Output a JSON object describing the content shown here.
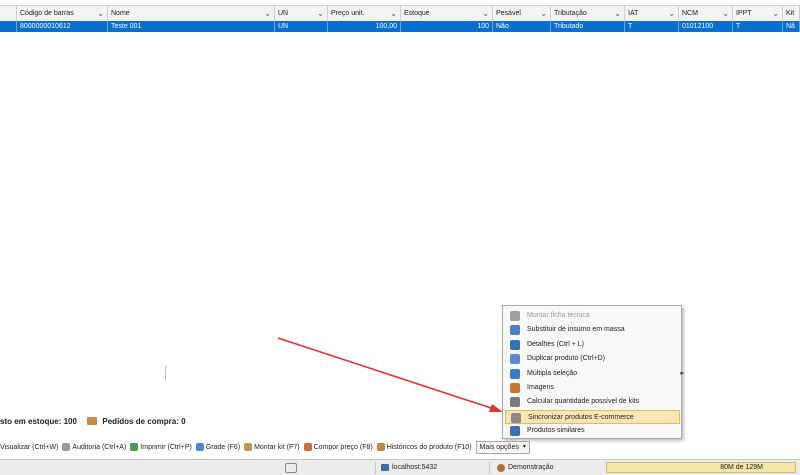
{
  "grid": {
    "columns": [
      {
        "label": "",
        "width": 17
      },
      {
        "label": "Código de barras",
        "width": 91
      },
      {
        "label": "Nome",
        "width": 167
      },
      {
        "label": "UN",
        "width": 53
      },
      {
        "label": "Preço unit.",
        "width": 73
      },
      {
        "label": "Estoque",
        "width": 92
      },
      {
        "label": "Pesável",
        "width": 58
      },
      {
        "label": "Tributação",
        "width": 74
      },
      {
        "label": "IAT",
        "width": 54
      },
      {
        "label": "NCM",
        "width": 54
      },
      {
        "label": "IPPT",
        "width": 50
      },
      {
        "label": "Kit",
        "width": 17
      }
    ],
    "rows": [
      {
        "cells": [
          "",
          "8000000010612",
          "Teste 001",
          "UN",
          "100,00",
          "100",
          "Não",
          "Tributado",
          "T",
          "01012100",
          "T",
          "Nã"
        ]
      }
    ]
  },
  "menu": {
    "items": [
      {
        "label": "Montar ficha técnica",
        "disabled": true,
        "icon": "gear-icon",
        "color": "#9aa0a6"
      },
      {
        "label": "Substituir de insumo em massa",
        "icon": "swap-icon",
        "color": "#4f7fc6"
      },
      {
        "label": "Detalhes (Ctrl + L)",
        "icon": "details-icon",
        "color": "#3a6fb0"
      },
      {
        "label": "Duplicar produto (Ctrl+D)",
        "icon": "duplicate-icon",
        "color": "#5b8ad1"
      },
      {
        "label": "Múltipla seleção",
        "icon": "multi-select-icon",
        "color": "#3b7ac8",
        "submenu": true
      },
      {
        "label": "Imagens",
        "icon": "images-icon",
        "color": "#c8752e"
      },
      {
        "label": "Calcular quantidade possível de kits",
        "icon": "calculator-icon",
        "color": "#7a7a7a"
      },
      {
        "label": "Sincronizar produtos E-commerce",
        "icon": "sync-icon",
        "color": "#8a8a8a",
        "highlight": true
      },
      {
        "label": "Produtos similares",
        "icon": "similar-icon",
        "color": "#3e6fb6"
      }
    ]
  },
  "summary": {
    "stock_label": "sto em estoque: 100",
    "orders_label": "Pedidos de compra: 0"
  },
  "toolbar": {
    "items": [
      {
        "label": "Visualizar (Ctrl+W)",
        "icon": "",
        "color": ""
      },
      {
        "label": "Auditoria (Ctrl+A)",
        "icon": "audit-icon",
        "color": "#9a9a9a"
      },
      {
        "label": "Imprimir (Ctrl+P)",
        "icon": "print-icon",
        "color": "#4c9a54"
      },
      {
        "label": "Grade (F6)",
        "icon": "grid-icon",
        "color": "#4c8ad3"
      },
      {
        "label": "Montar kit (F7)",
        "icon": "kit-icon",
        "color": "#b59a4d"
      },
      {
        "label": "Compor preço (F8)",
        "icon": "price-icon",
        "color": "#d26c3a"
      },
      {
        "label": "Históricos do produto (F10)",
        "icon": "history-icon",
        "color": "#c8843a"
      }
    ],
    "more_label": "Mais opções"
  },
  "status": {
    "host": "localhost:5432",
    "user": "Demonstração",
    "memory": "80M de 129M"
  }
}
